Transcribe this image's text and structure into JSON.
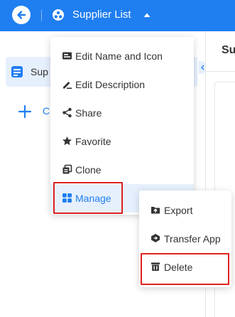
{
  "header": {
    "app_title": "Supplier List"
  },
  "sidebar": {
    "active_item_label": "Sup",
    "create_label": "C"
  },
  "right_pane": {
    "title": "Sup"
  },
  "menu": {
    "items": [
      {
        "label": "Edit Name and Icon",
        "icon": "edit-name-icon"
      },
      {
        "label": "Edit Description",
        "icon": "edit-description-icon"
      },
      {
        "label": "Share",
        "icon": "share-icon"
      },
      {
        "label": "Favorite",
        "icon": "star-icon"
      },
      {
        "label": "Clone",
        "icon": "clone-icon"
      },
      {
        "label": "Manage",
        "icon": "grid-icon"
      }
    ]
  },
  "submenu": {
    "items": [
      {
        "label": "Export",
        "icon": "export-icon"
      },
      {
        "label": "Transfer App",
        "icon": "transfer-icon"
      },
      {
        "label": "Delete",
        "icon": "trash-icon"
      }
    ]
  },
  "colors": {
    "header_bg": "#1f7ef0",
    "accent": "#1f7ef0",
    "highlight_border": "#e0211c"
  }
}
